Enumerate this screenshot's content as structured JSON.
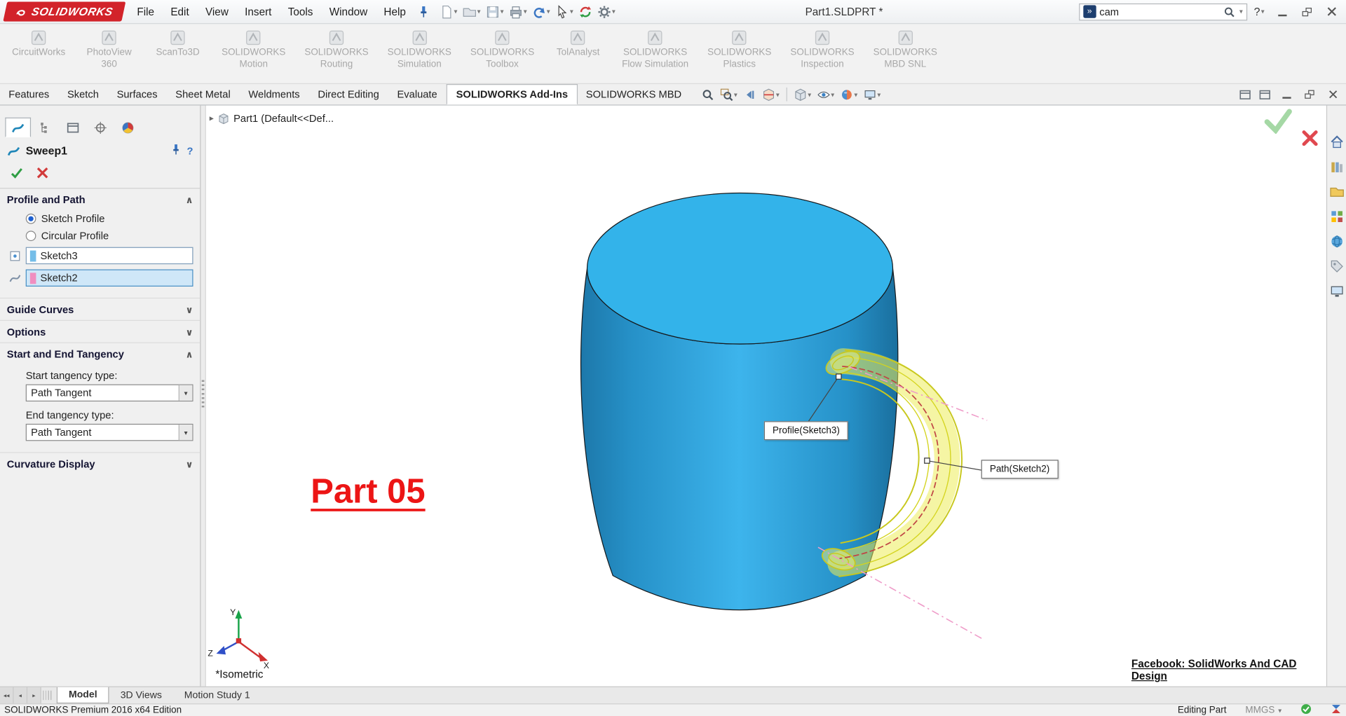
{
  "icons": {
    "chevron_down": "▾",
    "chevron_small_down": "∨",
    "chevron_small_up": "∧",
    "breadcrumb_arrow": "▸",
    "nav_first": "◂◂",
    "nav_prev": "◂",
    "nav_next": "▸",
    "help": "?"
  },
  "titlebar": {
    "brand": "SOLIDWORKS",
    "menus": [
      "File",
      "Edit",
      "View",
      "Insert",
      "Tools",
      "Window",
      "Help"
    ],
    "title": "Part1.SLDPRT *",
    "search_value": "cam"
  },
  "addins": [
    {
      "line1": "CircuitWorks",
      "line2": ""
    },
    {
      "line1": "PhotoView",
      "line2": "360"
    },
    {
      "line1": "ScanTo3D",
      "line2": ""
    },
    {
      "line1": "SOLIDWORKS",
      "line2": "Motion"
    },
    {
      "line1": "SOLIDWORKS",
      "line2": "Routing"
    },
    {
      "line1": "SOLIDWORKS",
      "line2": "Simulation"
    },
    {
      "line1": "SOLIDWORKS",
      "line2": "Toolbox"
    },
    {
      "line1": "TolAnalyst",
      "line2": ""
    },
    {
      "line1": "SOLIDWORKS",
      "line2": "Flow Simulation"
    },
    {
      "line1": "SOLIDWORKS",
      "line2": "Plastics"
    },
    {
      "line1": "SOLIDWORKS",
      "line2": "Inspection"
    },
    {
      "line1": "SOLIDWORKS",
      "line2": "MBD SNL"
    }
  ],
  "ribbon_tabs": [
    "Features",
    "Sketch",
    "Surfaces",
    "Sheet Metal",
    "Weldments",
    "Direct Editing",
    "Evaluate",
    "SOLIDWORKS Add-Ins",
    "SOLIDWORKS MBD"
  ],
  "property_manager": {
    "title": "Sweep1",
    "profile_path_header": "Profile and Path",
    "radio_sketch_profile": "Sketch Profile",
    "radio_circular_profile": "Circular Profile",
    "profile_value": "Sketch3",
    "path_value": "Sketch2",
    "guide_curves_header": "Guide Curves",
    "options_header": "Options",
    "tangency_header": "Start and End Tangency",
    "start_tangency_label": "Start tangency type:",
    "start_tangency_value": "Path Tangent",
    "end_tangency_label": "End tangency type:",
    "end_tangency_value": "Path Tangent",
    "curvature_header": "Curvature Display"
  },
  "viewport": {
    "breadcrumb": "Part1  (Default<<Def...",
    "callout_profile": "Profile(Sketch3)",
    "callout_path": "Path(Sketch2)",
    "watermark": "Part 05",
    "view_label": "*Isometric",
    "credit": "Facebook: SolidWorks And CAD Design",
    "axis_x": "X",
    "axis_y": "Y",
    "axis_z": "Z"
  },
  "doc_tabs": [
    "Model",
    "3D Views",
    "Motion Study 1"
  ],
  "statusbar": {
    "product": "SOLIDWORKS Premium 2016 x64 Edition",
    "mode": "Editing Part",
    "units": "MMGS"
  },
  "colors": {
    "brand_red": "#d2232a",
    "mug_blue": "#2fa8e0",
    "sweep_yellow": "#e3e23c",
    "watermark_red": "#ec1515"
  }
}
